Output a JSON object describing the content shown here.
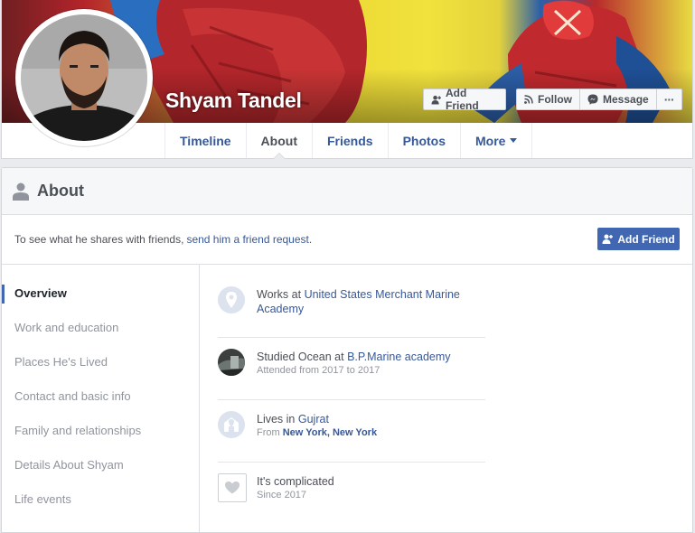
{
  "profile": {
    "name": "Shyam Tandel"
  },
  "cover_buttons": {
    "add_friend": "Add Friend",
    "follow": "Follow",
    "message": "Message",
    "more": "···"
  },
  "tabs": [
    {
      "label": "Timeline"
    },
    {
      "label": "About"
    },
    {
      "label": "Friends"
    },
    {
      "label": "Photos"
    },
    {
      "label": "More"
    }
  ],
  "about": {
    "title": "About",
    "notice_text": "To see what he shares with friends,",
    "notice_link": "send him a friend request",
    "notice_end": ".",
    "add_friend": "Add Friend"
  },
  "side_nav": [
    {
      "label": "Overview"
    },
    {
      "label": "Work and education"
    },
    {
      "label": "Places He's Lived"
    },
    {
      "label": "Contact and basic info"
    },
    {
      "label": "Family and relationships"
    },
    {
      "label": "Details About Shyam"
    },
    {
      "label": "Life events"
    }
  ],
  "overview": {
    "work": {
      "prefix": "Works at",
      "link": "United States Merchant Marine Academy"
    },
    "education": {
      "prefix": "Studied Ocean at",
      "link": "B.P.Marine academy",
      "sub": "Attended from 2017 to 2017"
    },
    "lives": {
      "prefix": "Lives in",
      "link": "Gujrat",
      "sub_prefix": "From",
      "sub_link": "New York, New York"
    },
    "relationship": {
      "status": "It's complicated",
      "sub": "Since 2017"
    }
  },
  "colors": {
    "link": "#365899",
    "primary_button": "#4267b2",
    "active_indicator": "#4267b2",
    "muted_text": "#90949c"
  },
  "icons": {
    "add_friend": "add-friend-icon",
    "follow": "rss-icon",
    "message": "messenger-icon",
    "about": "person-silhouette-icon",
    "work": "map-pin-icon",
    "education": "school-photo",
    "lives": "house-pin-icon",
    "relationship": "heart-icon"
  }
}
